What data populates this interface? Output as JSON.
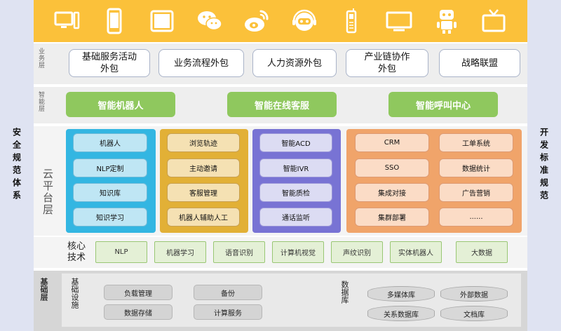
{
  "left_pillar": "安全规范体系",
  "right_pillar": "开发标准规范",
  "devices": [
    "desktop-icon",
    "phone-icon",
    "tablet-icon",
    "wechat-icon",
    "weibo-icon",
    "chatbot-icon",
    "walkie-talkie-icon",
    "tv-screen-icon",
    "robot-icon",
    "television-icon"
  ],
  "business_layer": {
    "label": "业务层",
    "items": [
      "基础服务活动\n外包",
      "业务流程外包",
      "人力资源外包",
      "产业链协作\n外包",
      "战略联盟"
    ]
  },
  "smart_layer": {
    "label": "智能层",
    "items": [
      "智能机器人",
      "智能在线客服",
      "智能呼叫中心"
    ]
  },
  "cloud_layer": {
    "label": "云平台层",
    "blue": [
      "机器人",
      "NLP定制",
      "知识库",
      "知识学习"
    ],
    "gold": [
      "浏览轨迹",
      "主动邀请",
      "客服管理",
      "机器人辅助人工"
    ],
    "purple": [
      "智能ACD",
      "智能IVR",
      "智能质检",
      "通话监听"
    ],
    "orange": [
      "CRM",
      "工单系统",
      "SSO",
      "数据统计",
      "集成对接",
      "广告营销",
      "集群部署",
      "......"
    ]
  },
  "core_tech": {
    "label": "核心\n技术",
    "items": [
      "NLP",
      "机器学习",
      "语音识别",
      "计算机视觉",
      "声纹识别",
      "实体机器人",
      "大数据"
    ]
  },
  "base_layer": {
    "label": "基础层",
    "infra_label": "基础设施",
    "infra": [
      "负载管理",
      "备份",
      "数据存储",
      "计算服务"
    ],
    "db_label": "数据库",
    "db": [
      "多媒体库",
      "外部数据",
      "关系数据库",
      "文档库"
    ]
  },
  "colors": {
    "device_bar": "#fbc13a",
    "smart_green": "#8fc85e",
    "cloud_blue": "#33b6e2",
    "cloud_gold": "#e2b036",
    "cloud_purple": "#7873d4",
    "cloud_orange": "#f0a46a"
  }
}
